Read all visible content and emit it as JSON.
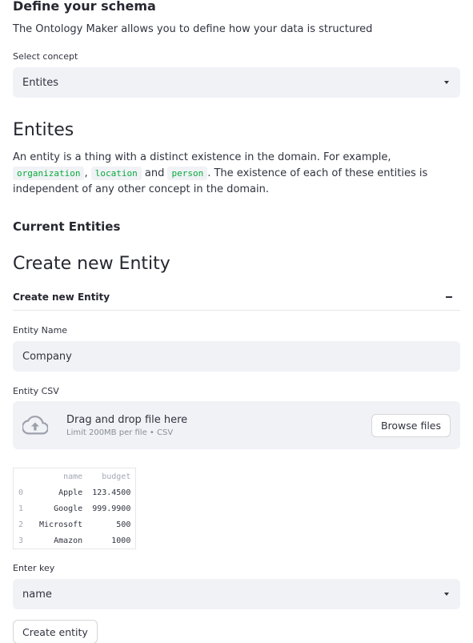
{
  "header": {
    "title": "Define your schema",
    "intro": "The Ontology Maker allows you to define how your data is structured"
  },
  "concept_select": {
    "label": "Select concept",
    "value": "Entites"
  },
  "section": {
    "heading": "Entites",
    "desc_part1": "An entity is a thing with a distinct existence in the domain. For example, ",
    "code1": "organization",
    "sep1": ", ",
    "code2": "location",
    "sep2": " and ",
    "code3": "person",
    "desc_part2": ". The existence of each of these entities is independent of any other concept in the domain."
  },
  "current_heading": "Current Entities",
  "create_heading": "Create new Entity",
  "expander": {
    "title": "Create new Entity"
  },
  "entity_name": {
    "label": "Entity Name",
    "value": "Company"
  },
  "entity_csv": {
    "label": "Entity CSV",
    "drop_text": "Drag and drop file here",
    "limit_text": "Limit 200MB per file • CSV",
    "browse_label": "Browse files"
  },
  "table": {
    "columns": [
      "name",
      "budget"
    ],
    "rows": [
      {
        "index": "0",
        "name": "Apple",
        "budget": "123.4500"
      },
      {
        "index": "1",
        "name": "Google",
        "budget": "999.9900"
      },
      {
        "index": "2",
        "name": "Microsoft",
        "budget": "500"
      },
      {
        "index": "3",
        "name": "Amazon",
        "budget": "1000"
      }
    ]
  },
  "key_select": {
    "label": "Enter key",
    "value": "name"
  },
  "create_button": "Create entity",
  "colors": {
    "accent_code": "#09ab3b",
    "input_bg": "#f0f2f6",
    "text": "#31333f"
  },
  "icons": [
    "cloud-upload-icon",
    "chevron-down-icon",
    "collapse-icon"
  ]
}
